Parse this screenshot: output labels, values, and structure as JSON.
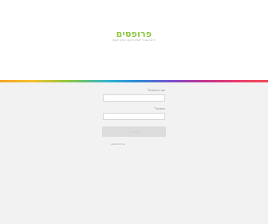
{
  "header": {
    "logo_text": "פרופסים",
    "tagline": "כל מה שצריך לשלוח הודעה, ישירות לעסק"
  },
  "form": {
    "username_label": "שם משתמש*",
    "username_value": "",
    "password_label": "סיסמא*",
    "password_value": "",
    "submit_label": "התחבר",
    "forgot_link": "שכחתי סיסמא"
  },
  "colors": {
    "brand": "#8cc63f",
    "background": "#f2f2f2"
  }
}
